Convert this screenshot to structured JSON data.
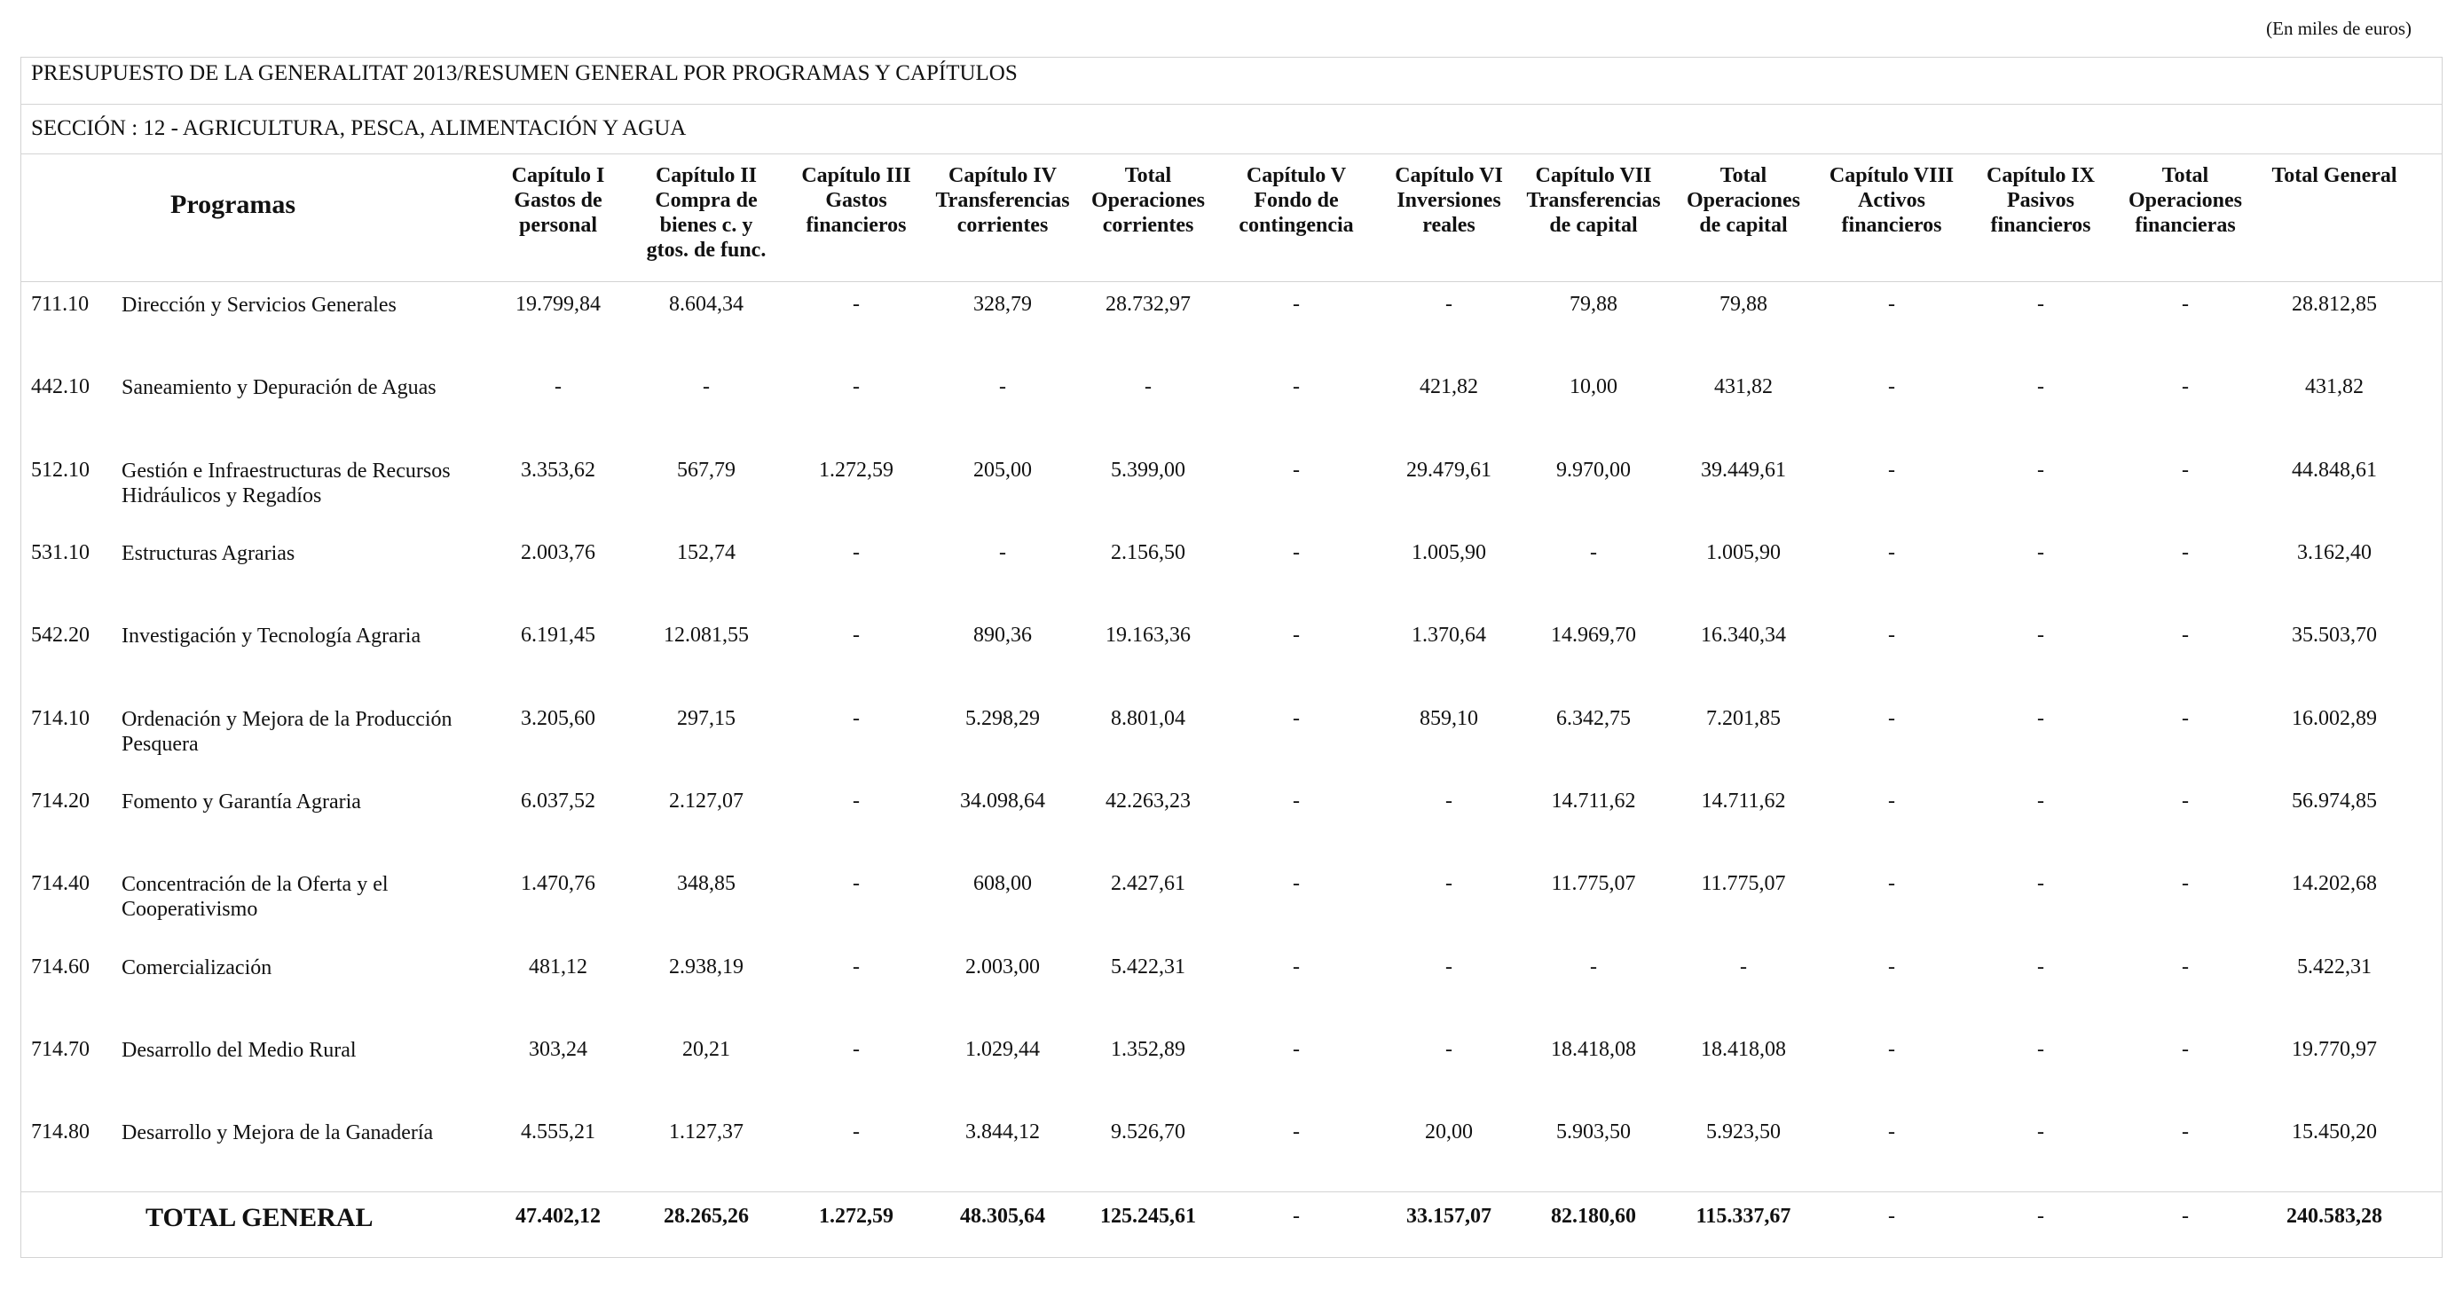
{
  "units_note": "(En miles de euros)",
  "title": "PRESUPUESTO DE LA GENERALITAT 2013/RESUMEN GENERAL POR PROGRAMAS Y CAPÍTULOS",
  "section": "SECCIÓN : 12  -  AGRICULTURA, PESCA, ALIMENTACIÓN Y AGUA",
  "programs_header": "Programas",
  "columns": [
    "Capítulo I\nGastos de\npersonal",
    "Capítulo II\nCompra de\nbienes c. y\ngtos. de func.",
    "Capítulo III\nGastos\nfinancieros",
    "Capítulo IV\nTransferencias\ncorrientes",
    "Total\nOperaciones\ncorrientes",
    "Capítulo V\nFondo de\ncontingencia",
    "Capítulo VI\nInversiones\nreales",
    "Capítulo VII\nTransferencias\nde capital",
    "Total\nOperaciones\nde capital",
    "Capítulo VIII\nActivos\nfinancieros",
    "Capítulo IX\nPasivos\nfinancieros",
    "Total\nOperaciones\nfinancieras",
    "Total General"
  ],
  "rows": [
    {
      "code": "711.10",
      "name": "Dirección y Servicios Generales",
      "values": [
        "19.799,84",
        "8.604,34",
        "-",
        "328,79",
        "28.732,97",
        "-",
        "-",
        "79,88",
        "79,88",
        "-",
        "-",
        "-",
        "28.812,85"
      ]
    },
    {
      "code": "442.10",
      "name": "Saneamiento y Depuración de Aguas",
      "values": [
        "-",
        "-",
        "-",
        "-",
        "-",
        "-",
        "421,82",
        "10,00",
        "431,82",
        "-",
        "-",
        "-",
        "431,82"
      ]
    },
    {
      "code": "512.10",
      "name": "Gestión e Infraestructuras de Recursos Hidráulicos y Regadíos",
      "values": [
        "3.353,62",
        "567,79",
        "1.272,59",
        "205,00",
        "5.399,00",
        "-",
        "29.479,61",
        "9.970,00",
        "39.449,61",
        "-",
        "-",
        "-",
        "44.848,61"
      ]
    },
    {
      "code": "531.10",
      "name": "Estructuras Agrarias",
      "values": [
        "2.003,76",
        "152,74",
        "-",
        "-",
        "2.156,50",
        "-",
        "1.005,90",
        "-",
        "1.005,90",
        "-",
        "-",
        "-",
        "3.162,40"
      ]
    },
    {
      "code": "542.20",
      "name": "Investigación y Tecnología Agraria",
      "values": [
        "6.191,45",
        "12.081,55",
        "-",
        "890,36",
        "19.163,36",
        "-",
        "1.370,64",
        "14.969,70",
        "16.340,34",
        "-",
        "-",
        "-",
        "35.503,70"
      ]
    },
    {
      "code": "714.10",
      "name": "Ordenación y Mejora de la Producción Pesquera",
      "values": [
        "3.205,60",
        "297,15",
        "-",
        "5.298,29",
        "8.801,04",
        "-",
        "859,10",
        "6.342,75",
        "7.201,85",
        "-",
        "-",
        "-",
        "16.002,89"
      ]
    },
    {
      "code": "714.20",
      "name": "Fomento y Garantía Agraria",
      "values": [
        "6.037,52",
        "2.127,07",
        "-",
        "34.098,64",
        "42.263,23",
        "-",
        "-",
        "14.711,62",
        "14.711,62",
        "-",
        "-",
        "-",
        "56.974,85"
      ]
    },
    {
      "code": "714.40",
      "name": "Concentración de la Oferta y el Cooperativismo",
      "values": [
        "1.470,76",
        "348,85",
        "-",
        "608,00",
        "2.427,61",
        "-",
        "-",
        "11.775,07",
        "11.775,07",
        "-",
        "-",
        "-",
        "14.202,68"
      ]
    },
    {
      "code": "714.60",
      "name": "Comercialización",
      "values": [
        "481,12",
        "2.938,19",
        "-",
        "2.003,00",
        "5.422,31",
        "-",
        "-",
        "-",
        "-",
        "-",
        "-",
        "-",
        "5.422,31"
      ]
    },
    {
      "code": "714.70",
      "name": "Desarrollo del Medio Rural",
      "values": [
        "303,24",
        "20,21",
        "-",
        "1.029,44",
        "1.352,89",
        "-",
        "-",
        "18.418,08",
        "18.418,08",
        "-",
        "-",
        "-",
        "19.770,97"
      ]
    },
    {
      "code": "714.80",
      "name": "Desarrollo y Mejora de la Ganadería",
      "values": [
        "4.555,21",
        "1.127,37",
        "-",
        "3.844,12",
        "9.526,70",
        "-",
        "20,00",
        "5.903,50",
        "5.923,50",
        "-",
        "-",
        "-",
        "15.450,20"
      ]
    }
  ],
  "total": {
    "label": "TOTAL GENERAL",
    "values": [
      "47.402,12",
      "28.265,26",
      "1.272,59",
      "48.305,64",
      "125.245,61",
      "-",
      "33.157,07",
      "82.180,60",
      "115.337,67",
      "-",
      "-",
      "-",
      "240.583,28"
    ]
  }
}
